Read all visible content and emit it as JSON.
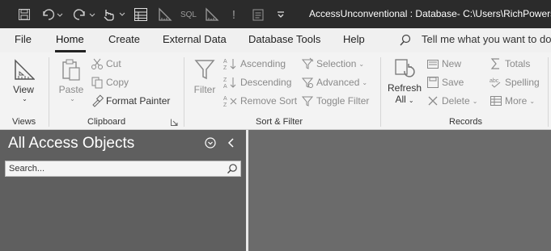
{
  "titlebar": {
    "title": "AccessUnconventional : Database- C:\\Users\\RichPowers\\",
    "qa_icons": [
      "save-icon",
      "undo-icon",
      "redo-icon",
      "touch-mode-icon",
      "view-icon",
      "design-view-icon",
      "sql-view-icon",
      "design-view-icon",
      "run-icon",
      "property-sheet-icon",
      "customize-qat-icon"
    ],
    "sql_label": "SQL",
    "run_label": "!"
  },
  "menu": {
    "tabs": [
      "File",
      "Home",
      "Create",
      "External Data",
      "Database Tools",
      "Help"
    ],
    "active_tab": "Home",
    "tellme": "Tell me what you want to do"
  },
  "ribbon": {
    "views": {
      "view": "View",
      "group": "Views"
    },
    "clipboard": {
      "paste": "Paste",
      "cut": "Cut",
      "copy": "Copy",
      "format_painter": "Format Painter",
      "group": "Clipboard"
    },
    "sort_filter": {
      "filter": "Filter",
      "ascending": "Ascending",
      "descending": "Descending",
      "remove_sort": "Remove Sort",
      "selection": "Selection",
      "advanced": "Advanced",
      "toggle_filter": "Toggle Filter",
      "group": "Sort & Filter"
    },
    "records": {
      "refresh": "Refresh",
      "refresh_all": "All",
      "new": "New",
      "save": "Save",
      "delete": "Delete",
      "totals": "Totals",
      "spelling": "Spelling",
      "more": "More",
      "group": "Records"
    }
  },
  "navpane": {
    "title": "All Access Objects",
    "search_placeholder": "Search..."
  },
  "colors": {
    "titlebar": "#2b2b2b",
    "ribbon": "#f3f3f3",
    "navpane": "#5f5f5f",
    "workspace": "#6b6b6b"
  }
}
